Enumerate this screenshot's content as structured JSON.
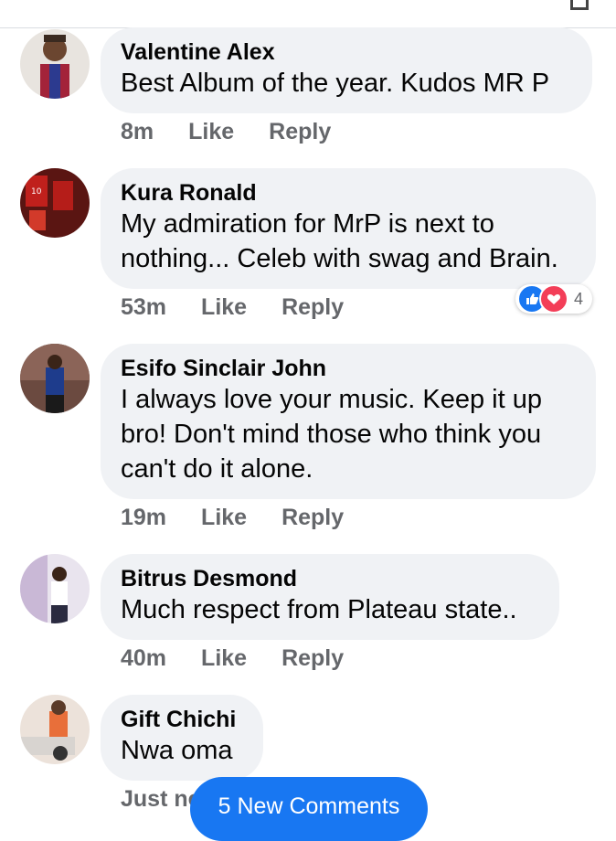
{
  "colors": {
    "accent": "#1877f2",
    "bubble": "#f0f2f5",
    "meta_text": "#65676b",
    "love": "#f33e58"
  },
  "comments": [
    {
      "author": "Valentine Alex",
      "lines": [
        "Best Album of the year. Kudos MR P"
      ],
      "time": "8m",
      "like_label": "Like",
      "reply_label": "Reply"
    },
    {
      "author": "Kura Ronald",
      "lines": [
        "My admiration for MrP is next to",
        "nothing... Celeb with swag and Brain."
      ],
      "time": "53m",
      "like_label": "Like",
      "reply_label": "Reply",
      "reactions": {
        "types": [
          "like-icon",
          "love-icon"
        ],
        "count": "4"
      }
    },
    {
      "author": "Esifo Sinclair John",
      "lines": [
        "I always love your music. Keep it up",
        "bro! Don't mind those who think you",
        "can't do it alone."
      ],
      "time": "19m",
      "like_label": "Like",
      "reply_label": "Reply"
    },
    {
      "author": "Bitrus Desmond",
      "lines": [
        "Much respect from Plateau state.."
      ],
      "time": "40m",
      "like_label": "Like",
      "reply_label": "Reply"
    },
    {
      "author": "Gift Chichi",
      "lines": [
        "Nwa oma"
      ],
      "time": "Just no",
      "like_label": "",
      "reply_label": ""
    }
  ],
  "new_comments_button": "5 New Comments"
}
